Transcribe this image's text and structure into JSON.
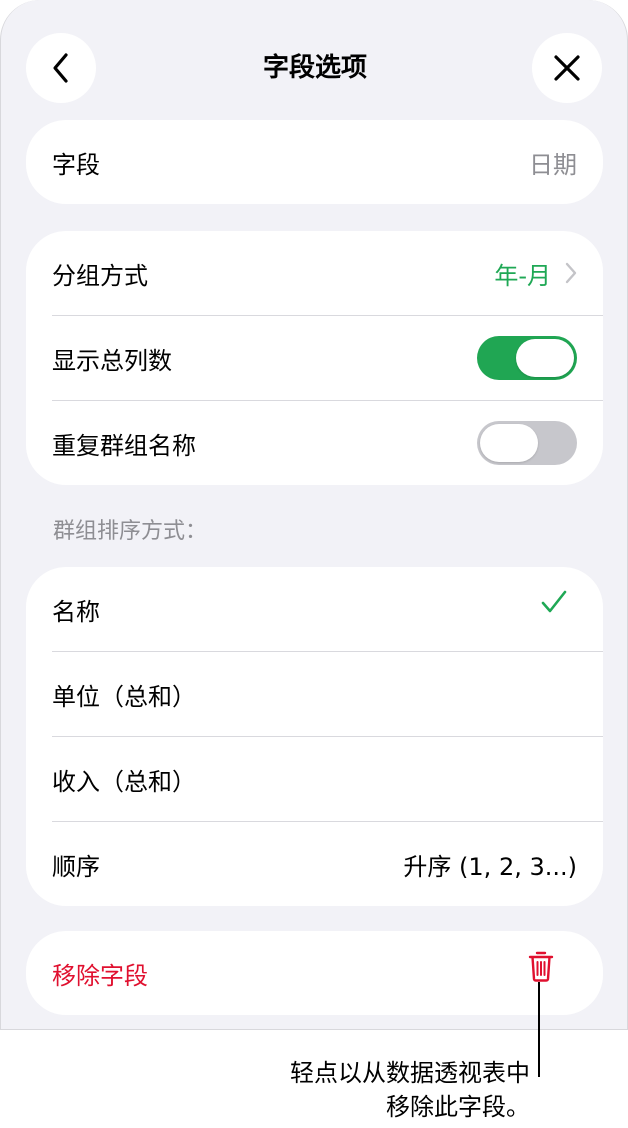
{
  "nav": {
    "title": "字段选项",
    "back_icon": "chevron-left-icon",
    "close_icon": "close-icon"
  },
  "field_row": {
    "label": "字段",
    "value": "日期"
  },
  "options": {
    "group_by_label": "分组方式",
    "group_by_value": "年-月",
    "show_total_label": "显示总列数",
    "show_total_on": true,
    "repeat_names_label": "重复群组名称",
    "repeat_names_on": false
  },
  "sort": {
    "header": "群组排序方式：",
    "items": [
      {
        "label": "名称"
      },
      {
        "label": "单位（总和）"
      },
      {
        "label": "收入（总和）"
      }
    ],
    "order_label": "顺序",
    "order_value": "升序 (1, 2, 3...)"
  },
  "remove": {
    "label": "移除字段",
    "icon": "trash-icon"
  },
  "callout": {
    "line1": "轻点以从数据透视表中",
    "line2": "移除此字段。"
  },
  "colors": {
    "accent_green": "#1fa855",
    "destructive_red": "#e0102f",
    "background": "#f2f2f7"
  }
}
